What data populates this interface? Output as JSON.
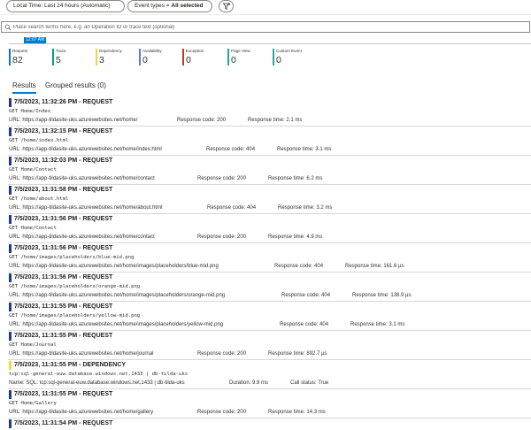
{
  "toolbar": {
    "time_range": "Local Time: Last 24 hours (Automatic)",
    "event_types_prefix": "Event types = ",
    "event_types_value": "All selected"
  },
  "search": {
    "placeholder": "Place search terms here, e.g. an Operation ID or trace text (optional)"
  },
  "timeline": {
    "marker": "12:07 AM"
  },
  "counters": [
    {
      "label": "Request",
      "value": "82",
      "color": "#0078d4"
    },
    {
      "label": "Trace",
      "value": "5",
      "color": "#00a383"
    },
    {
      "label": "Dependency",
      "value": "3",
      "color": "#f0d342"
    },
    {
      "label": "Availability",
      "value": "0",
      "color": "#5a7bd1"
    },
    {
      "label": "Exception",
      "value": "0",
      "color": "#c0392b"
    },
    {
      "label": "Page View",
      "value": "0",
      "color": "#1aa79a"
    },
    {
      "label": "Custom Event",
      "value": "0",
      "color": "#2bab8e"
    }
  ],
  "tabs": {
    "results": "Results",
    "grouped": "Grouped results (0)"
  },
  "colors": {
    "request": "#1e3a8a",
    "dependency": "#f5d445"
  },
  "results": [
    {
      "title": "7/5/2023, 11:32:26 PM - REQUEST",
      "detail": "GET Home/Index",
      "meta": [
        "URL: https://app-tildasite-uks.azurewebsites.net/home/",
        "Response code: 200",
        "Response time: 2.1 ms"
      ]
    },
    {
      "title": "7/5/2023, 11:32:15 PM - REQUEST",
      "detail": "GET /home/index.html",
      "meta": [
        "URL: https://app-tildasite-uks.azurewebsites.net/home/index.html",
        "Response code: 404",
        "Response time: 3.1 ms"
      ]
    },
    {
      "title": "7/5/2023, 11:32:03 PM - REQUEST",
      "detail": "GET Home/Contact",
      "meta": [
        "URL: https://app-tildasite-uks.azurewebsites.net/home/contact",
        "Response code: 200",
        "Response time: 6.2 ms"
      ]
    },
    {
      "title": "7/5/2023, 11:31:58 PM - REQUEST",
      "detail": "GET /home/about.html",
      "meta": [
        "URL: https://app-tildasite-uks.azurewebsites.net/home/about.html",
        "Response code: 404",
        "Response time: 3.2 ms"
      ]
    },
    {
      "title": "7/5/2023, 11:31:56 PM - REQUEST",
      "detail": "GET Home/Contact",
      "meta": [
        "URL: https://app-tildasite-uks.azurewebsites.net/home/contact",
        "Response code: 200",
        "Response time: 4.9 ms"
      ]
    },
    {
      "title": "7/5/2023, 11:31:56 PM - REQUEST",
      "detail": "GET /home/images/placeholders/blue-mid.png",
      "meta": [
        "URL: https://app-tildasite-uks.azurewebsites.net/home/images/placeholders/blue-mid.png",
        "Response code: 404",
        "Response time: 161.6 µs"
      ]
    },
    {
      "title": "7/5/2023, 11:31:56 PM - REQUEST",
      "detail": "GET /home/images/placeholders/orange-mid.png",
      "meta": [
        "URL: https://app-tildasite-uks.azurewebsites.net/home/images/placeholders/orange-mid.png",
        "Response code: 404",
        "Response time: 138.9 µs"
      ]
    },
    {
      "title": "7/5/2023, 11:31:55 PM - REQUEST",
      "detail": "GET /home/images/placeholders/yellow-mid.png",
      "meta": [
        "URL: https://app-tildasite-uks.azurewebsites.net/home/images/placeholders/yellow-mid.png",
        "Response code: 404",
        "Response time: 3.1 ms"
      ]
    },
    {
      "title": "7/5/2023, 11:31:55 PM - REQUEST",
      "detail": "GET Home/Journal",
      "meta": [
        "URL: https://app-tildasite-uks.azurewebsites.net/home/journal",
        "Response code: 200",
        "Response time: 892.7 µs"
      ]
    },
    {
      "title": "7/5/2023, 11:31:55 PM - DEPENDENCY",
      "detail": "tcp:sql-general-euw.database.windows.net,1433 | db-tilda-uks",
      "meta": [
        "Name: SQL: tcp:sql-general-euw.database.windows.net,1433 | db-tilda-uks",
        "Duration: 9.9 ms",
        "Call status: True"
      ]
    },
    {
      "title": "7/5/2023, 11:31:55 PM - REQUEST",
      "detail": "GET Home/Gallery",
      "meta": [
        "URL: https://app-tildasite-uks.azurewebsites.net/home/gallery",
        "Response code: 200",
        "Response time: 14.3 ms"
      ]
    },
    {
      "title": "7/5/2023, 11:31:54 PM - REQUEST",
      "detail": "",
      "meta": [
        "",
        "",
        ""
      ]
    }
  ]
}
